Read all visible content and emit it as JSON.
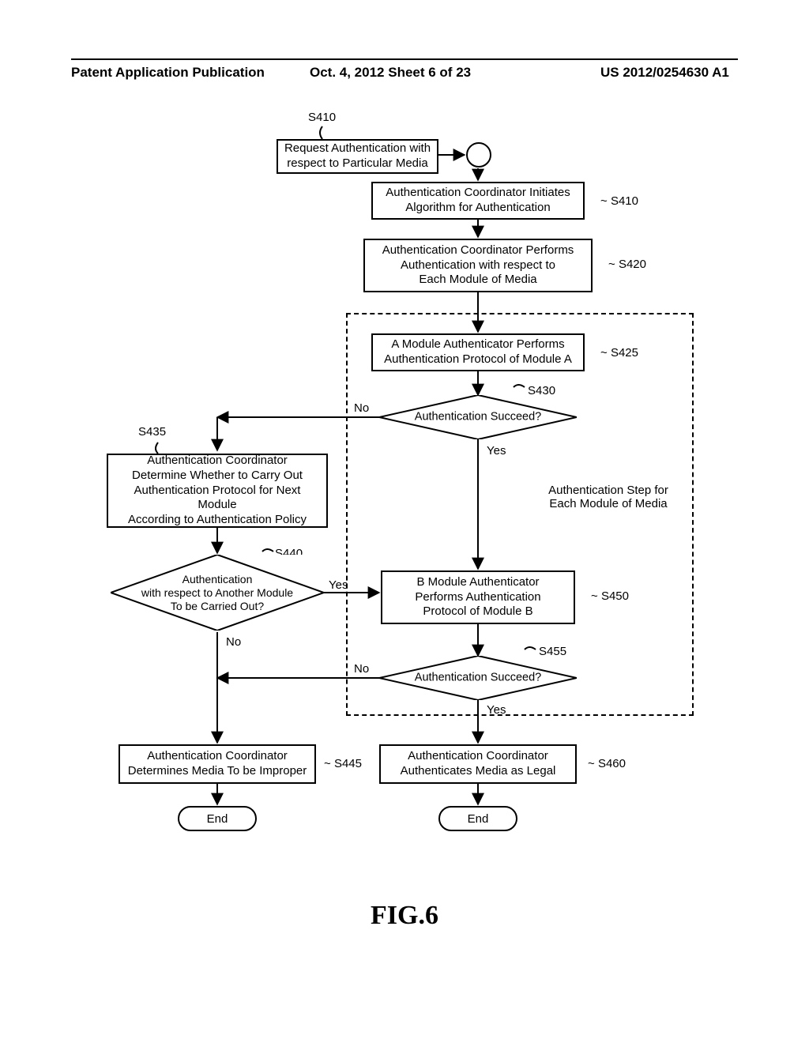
{
  "header": {
    "left": "Patent Application Publication",
    "center": "Oct. 4, 2012  Sheet 6 of 23",
    "right": "US 2012/0254630 A1"
  },
  "labels": {
    "s410_top": "S410",
    "s410_right": "S410",
    "s420": "S420",
    "s425": "S425",
    "s430": "S430",
    "s435": "S435",
    "s440": "S440",
    "s445": "S445",
    "s450": "S450",
    "s455": "S455",
    "s460": "S460",
    "no1": "No",
    "yes1": "Yes",
    "yes2": "Yes",
    "no2": "No",
    "no3": "No",
    "yes3": "Yes",
    "note_line1": "Authentication Step for",
    "note_line2": "Each Module of Media"
  },
  "boxes": {
    "request": "Request Authentication with\nrespect to Particular Media",
    "initiate": "Authentication Coordinator Initiates\nAlgorithm for Authentication",
    "performEach": "Authentication Coordinator Performs\nAuthentication with respect to\nEach Module of Media",
    "modA": "A Module Authenticator Performs\nAuthentication Protocol of Module A",
    "s435box": "Authentication Coordinator\nDetermine Whether to Carry Out\nAuthentication Protocol for Next Module\nAccording to Authentication Policy",
    "modB": "B Module Authenticator\nPerforms Authentication\nProtocol of Module B",
    "improper": "Authentication Coordinator\nDetermines Media To be Improper",
    "legal": "Authentication Coordinator\nAuthenticates Media as Legal"
  },
  "diamonds": {
    "d430": "Authentication Succeed?",
    "d440_l1": "Authentication",
    "d440_l2": "with respect to Another Module",
    "d440_l3": "To be Carried Out?",
    "d455": "Authentication Succeed?"
  },
  "terminators": {
    "end1": "End",
    "end2": "End"
  },
  "figure": "FIG.6",
  "chart_data": {
    "type": "flowchart",
    "title": "FIG.6",
    "nodes": [
      {
        "id": "S410a",
        "type": "process",
        "text": "Request Authentication with respect to Particular Media"
      },
      {
        "id": "conn",
        "type": "connector",
        "text": ""
      },
      {
        "id": "S410b",
        "type": "process",
        "text": "Authentication Coordinator Initiates Algorithm for Authentication"
      },
      {
        "id": "S420",
        "type": "process",
        "text": "Authentication Coordinator Performs Authentication with respect to Each Module of Media"
      },
      {
        "id": "S425",
        "type": "process",
        "text": "A Module Authenticator Performs Authentication Protocol of Module A",
        "group": "Authentication Step for Each Module of Media"
      },
      {
        "id": "S430",
        "type": "decision",
        "text": "Authentication Succeed?",
        "group": "Authentication Step for Each Module of Media"
      },
      {
        "id": "S435",
        "type": "process",
        "text": "Authentication Coordinator Determine Whether to Carry Out Authentication Protocol for Next Module According to Authentication Policy"
      },
      {
        "id": "S440",
        "type": "decision",
        "text": "Authentication with respect to Another Module To be Carried Out?"
      },
      {
        "id": "S445",
        "type": "process",
        "text": "Authentication Coordinator Determines Media To be Improper"
      },
      {
        "id": "S450",
        "type": "process",
        "text": "B Module Authenticator Performs Authentication Protocol of Module B",
        "group": "Authentication Step for Each Module of Media"
      },
      {
        "id": "S455",
        "type": "decision",
        "text": "Authentication Succeed?",
        "group": "Authentication Step for Each Module of Media"
      },
      {
        "id": "S460",
        "type": "process",
        "text": "Authentication Coordinator Authenticates Media as Legal"
      },
      {
        "id": "End1",
        "type": "terminator",
        "text": "End"
      },
      {
        "id": "End2",
        "type": "terminator",
        "text": "End"
      }
    ],
    "edges": [
      {
        "from": "S410a",
        "to": "conn"
      },
      {
        "from": "conn",
        "to": "S410b"
      },
      {
        "from": "S410b",
        "to": "S420"
      },
      {
        "from": "S420",
        "to": "S425"
      },
      {
        "from": "S425",
        "to": "S430"
      },
      {
        "from": "S430",
        "to": "S435",
        "label": "No"
      },
      {
        "from": "S430",
        "to": "S450",
        "label": "Yes"
      },
      {
        "from": "S435",
        "to": "S440"
      },
      {
        "from": "S440",
        "to": "S450",
        "label": "Yes"
      },
      {
        "from": "S440",
        "to": "S445",
        "label": "No"
      },
      {
        "from": "S450",
        "to": "S455"
      },
      {
        "from": "S455",
        "to": "S445",
        "label": "No"
      },
      {
        "from": "S455",
        "to": "S460",
        "label": "Yes"
      },
      {
        "from": "S445",
        "to": "End1"
      },
      {
        "from": "S460",
        "to": "End2"
      }
    ],
    "groups": [
      {
        "name": "Authentication Step for Each Module of Media",
        "members": [
          "S425",
          "S430",
          "S450",
          "S455"
        ]
      }
    ]
  }
}
